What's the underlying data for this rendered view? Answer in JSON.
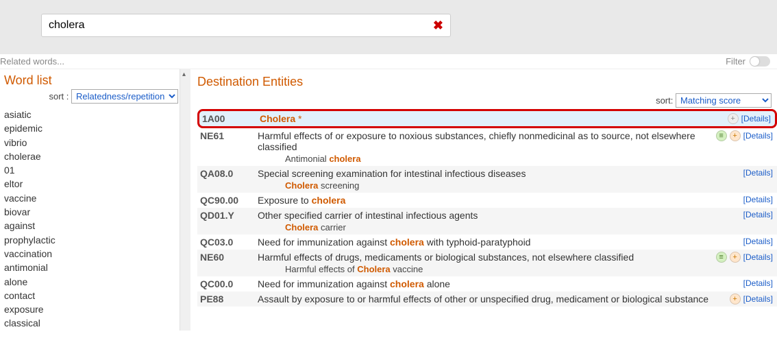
{
  "search": {
    "value": "cholera"
  },
  "meta": {
    "related": "Related words...",
    "filter_label": "Filter"
  },
  "left": {
    "title": "Word list",
    "sort_label": "sort :",
    "sort_value": "Relatedness/repetition",
    "words": [
      "asiatic",
      "epidemic",
      "vibrio",
      "cholerae",
      "01",
      "eltor",
      "vaccine",
      "biovar",
      "against",
      "prophylactic",
      "vaccination",
      "antimonial",
      "alone",
      "contact",
      "exposure",
      "classical"
    ]
  },
  "right": {
    "title": "Destination Entities",
    "sort_label": "sort:",
    "sort_value": "Matching score",
    "details_label": "[Details]",
    "rows": [
      {
        "code": "1A00",
        "highlight": true,
        "title_html": "<span class='title-match'>Cholera</span> <span class='star'>*</span>",
        "icons": [
          "plus"
        ]
      },
      {
        "code": "NE61",
        "title_html": "Harmful effects of or exposure to noxious substances, chiefly nonmedicinal as to source, not elsewhere classified",
        "sub_html": "Antimonial <span class='match'>cholera</span>",
        "icons": [
          "lines",
          "plus"
        ]
      },
      {
        "code": "QA08.0",
        "title_html": "Special screening examination for intestinal infectious diseases",
        "sub_html": "<span class='match'>Cholera</span> screening",
        "icons": []
      },
      {
        "code": "QC90.00",
        "title_html": "Exposure to <span class='match'>cholera</span>",
        "icons": []
      },
      {
        "code": "QD01.Y",
        "title_html": "Other specified carrier of intestinal infectious agents",
        "sub_html": "<span class='match'>Cholera</span> carrier",
        "icons": []
      },
      {
        "code": "QC03.0",
        "title_html": "Need for immunization against <span class='match'>cholera</span> with typhoid-paratyphoid",
        "icons": []
      },
      {
        "code": "NE60",
        "title_html": "Harmful effects of drugs, medicaments or biological substances, not elsewhere classified",
        "sub_html": "Harmful effects of <span class='match'>Cholera</span> vaccine",
        "icons": [
          "lines",
          "plus"
        ]
      },
      {
        "code": "QC00.0",
        "title_html": "Need for immunization against <span class='match'>cholera</span> alone",
        "icons": []
      },
      {
        "code": "PE88",
        "title_html": "Assault by exposure to or harmful effects of other or unspecified drug, medicament or biological substance",
        "icons": [
          "plus"
        ]
      }
    ]
  }
}
